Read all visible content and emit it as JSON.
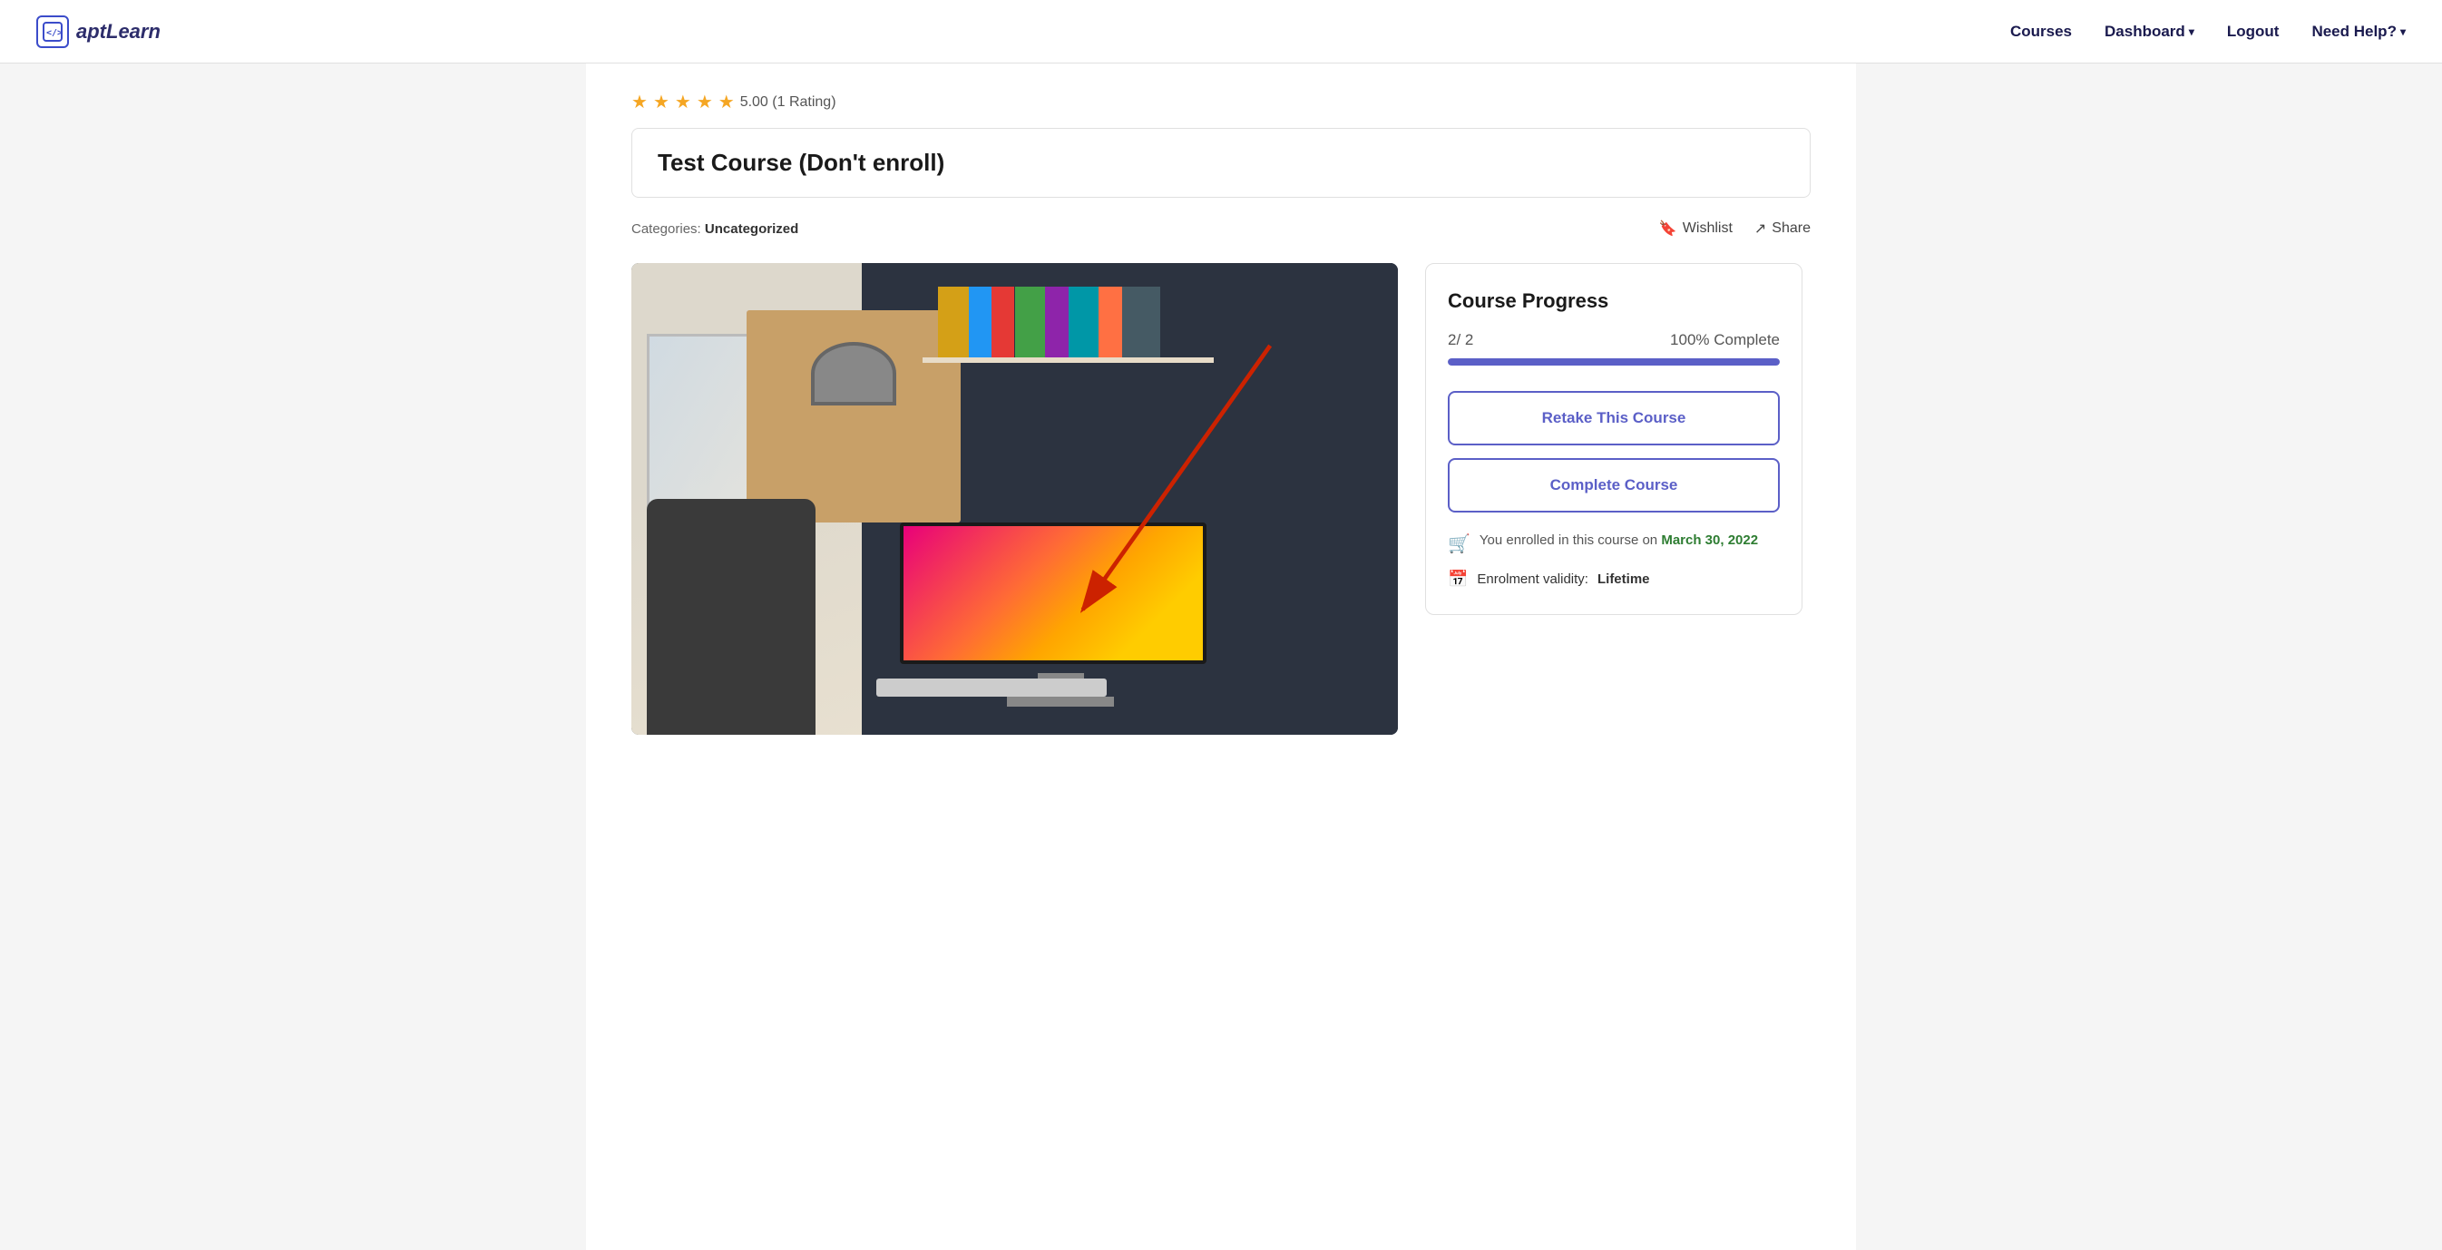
{
  "header": {
    "logo_apt": "apt",
    "logo_learn": "Learn",
    "logo_icon": "</>",
    "nav": {
      "courses": "Courses",
      "dashboard": "Dashboard",
      "logout": "Logout",
      "need_help": "Need Help?"
    }
  },
  "rating": {
    "stars": 5,
    "score": "5.00",
    "count": "1 Rating",
    "display": "5.00 (1 Rating)"
  },
  "course": {
    "title": "Test Course (Don't enroll)",
    "category_label": "Categories:",
    "category_value": "Uncategorized"
  },
  "actions": {
    "wishlist": "Wishlist",
    "share": "Share"
  },
  "progress": {
    "panel_title": "Course Progress",
    "current": "2",
    "total": "2",
    "fraction": "2/ 2",
    "percent": "100% Complete",
    "fill_width": "100%",
    "retake_label": "Retake This Course",
    "complete_label": "Complete Course",
    "enrollment_text": "You enrolled in this course on",
    "enrollment_date": "March 30, 2022",
    "validity_label": "Enrolment validity:",
    "validity_value": "Lifetime"
  }
}
